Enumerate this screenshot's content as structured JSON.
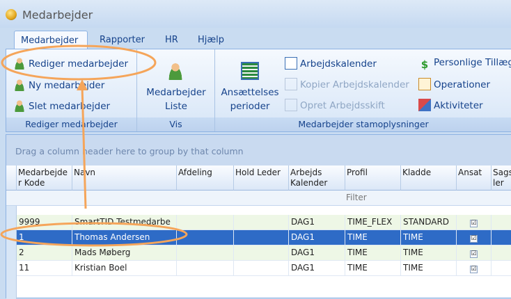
{
  "window": {
    "title": "Medarbejder"
  },
  "tabs": [
    "Medarbejder",
    "Rapporter",
    "HR",
    "Hjælp"
  ],
  "ribbon": {
    "groups": [
      {
        "label": "Rediger medarbejder",
        "buttons": [
          "Rediger medarbejder",
          "Ny medarbejder",
          "Slet medarbejder"
        ]
      },
      {
        "label": "Vis",
        "buttons": [
          "Medarbejder Liste"
        ]
      },
      {
        "label": "Medarbejder stamoplysninger",
        "buttons": [
          "Ansættelses perioder",
          "Arbejdskalender",
          "Kopier Arbejdskalender",
          "Opret Arbejdsskift",
          "Personlige Tillæg",
          "Operationer",
          "Aktiviteter"
        ]
      }
    ],
    "medarbejder_liste": {
      "line1": "Medarbejder",
      "line2": "Liste"
    },
    "ansaettelses": {
      "line1": "Ansættelses",
      "line2": "perioder"
    }
  },
  "grid": {
    "group_hint": "Drag a column header here to group by that column",
    "filter_label": "Filter",
    "headers": [
      "Medarbejde r Kode",
      "Navn",
      "Afdeling",
      "Hold Leder",
      "Arbejds Kalender",
      "Profil",
      "Kladde",
      "Ansat",
      "Sags ler"
    ],
    "rows": [
      [
        "9999",
        "SmartTID Testmedarbe",
        "",
        "",
        "DAG1",
        "TIME_FLEX",
        "STANDARD",
        "☑",
        ""
      ],
      [
        "1",
        "Thomas Andersen",
        "",
        "",
        "DAG1",
        "TIME",
        "TIME",
        "☑",
        ""
      ],
      [
        "2",
        "Mads Møberg",
        "",
        "",
        "DAG1",
        "TIME",
        "TIME",
        "☑",
        ""
      ],
      [
        "11",
        "Kristian Boel",
        "",
        "",
        "DAG1",
        "TIME",
        "TIME",
        "☑",
        ""
      ]
    ]
  },
  "colors": {
    "accent": "#f5a55a",
    "selection": "#2e6bc6"
  }
}
